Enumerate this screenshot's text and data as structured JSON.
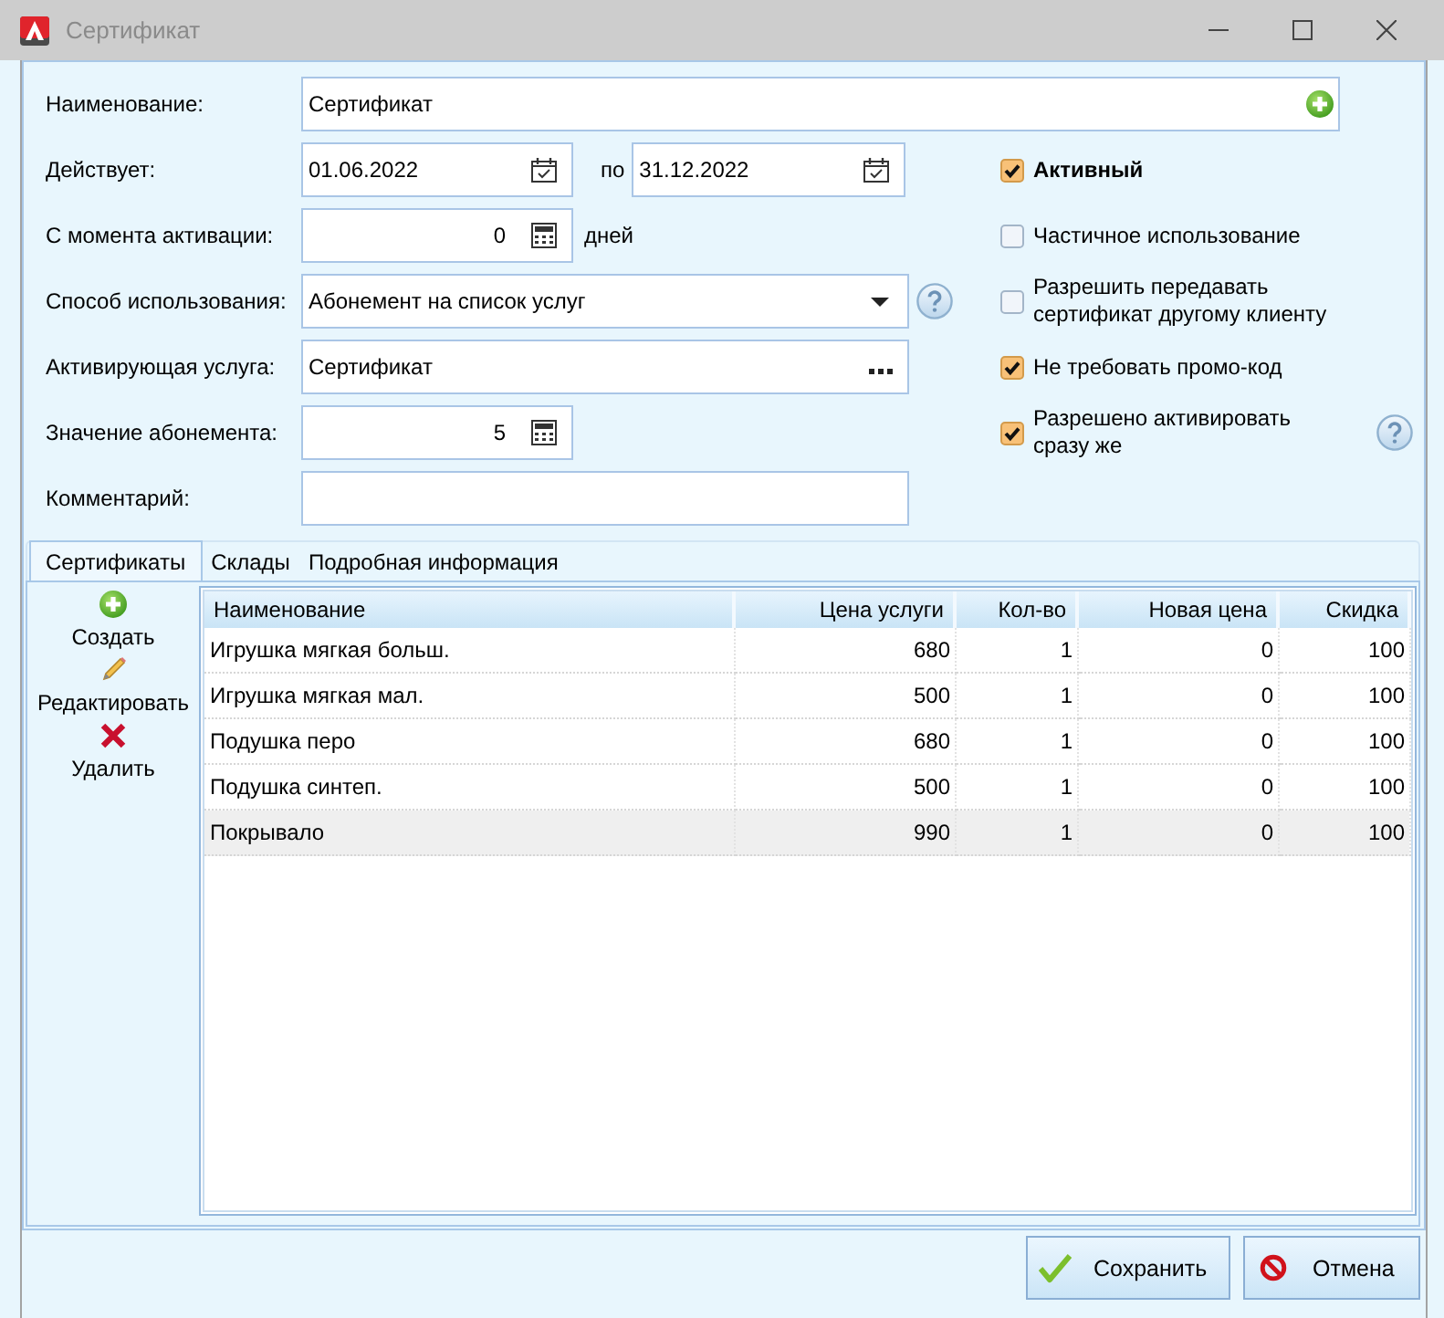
{
  "window": {
    "title": "Сертификат"
  },
  "form": {
    "fields": [
      {
        "kind": "text",
        "label": "Наименование:",
        "value": "Сертификат"
      },
      {
        "kind": "date_range",
        "label": "Действует:",
        "from": "01.06.2022",
        "separator": "по",
        "to": "31.12.2022"
      },
      {
        "kind": "number",
        "label": "С момента активации:",
        "value": "0",
        "unit": "дней"
      },
      {
        "kind": "dropdown",
        "label": "Способ использования:",
        "value": "Абонемент на список услуг"
      },
      {
        "kind": "lookup",
        "label": "Активирующая услуга:",
        "value": "Сертификат"
      },
      {
        "kind": "number",
        "label": "Значение абонемента:",
        "value": "5"
      },
      {
        "kind": "memo",
        "label": "Комментарий:"
      }
    ],
    "options": [
      {
        "label": "Активный",
        "checked": true
      },
      {
        "label": "Частичное использование",
        "checked": false
      },
      {
        "label": "Разрешить передавать сертификат другому клиенту",
        "checked": false
      },
      {
        "label": "Не требовать промо-код",
        "checked": true
      },
      {
        "label": "Разрешено активировать сразу же",
        "checked": true
      }
    ]
  },
  "tabs": [
    {
      "label": "Сертификаты",
      "selected": true
    },
    {
      "label": "Склады",
      "selected": false
    },
    {
      "label": "Подробная информация",
      "selected": false
    }
  ],
  "toolbar": [
    {
      "kind": "create",
      "label": "Создать"
    },
    {
      "kind": "edit",
      "label": "Редактировать"
    },
    {
      "kind": "delete",
      "label": "Удалить"
    }
  ],
  "table": {
    "columns": [
      "Наименование",
      "Цена услуги",
      "Кол-во",
      "Новая цена",
      "Скидка"
    ],
    "rows": [
      {
        "cells": [
          "Игрушка мягкая больш.",
          "680",
          "1",
          "0",
          "100"
        ],
        "selected": false
      },
      {
        "cells": [
          "Игрушка мягкая мал.",
          "500",
          "1",
          "0",
          "100"
        ],
        "selected": false
      },
      {
        "cells": [
          "Подушка перо",
          "680",
          "1",
          "0",
          "100"
        ],
        "selected": false
      },
      {
        "cells": [
          "Подушка синтеп.",
          "500",
          "1",
          "0",
          "100"
        ],
        "selected": false
      },
      {
        "cells": [
          "Покрывало",
          "990",
          "1",
          "0",
          "100"
        ],
        "selected": true
      }
    ]
  },
  "buttons": [
    {
      "kind": "save",
      "label": "Сохранить"
    },
    {
      "kind": "cancel",
      "label": "Отмена"
    }
  ]
}
